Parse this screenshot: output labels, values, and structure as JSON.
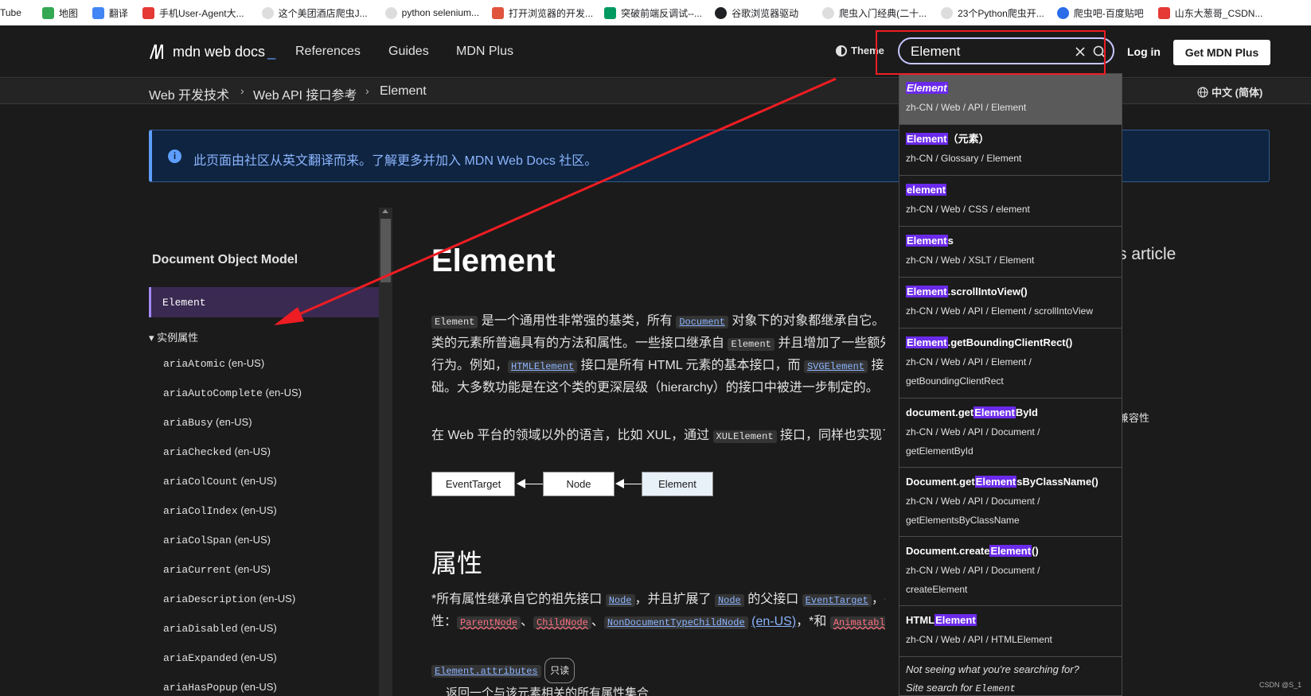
{
  "bookmarks": [
    {
      "label": "Tube",
      "color": "#ffffff"
    },
    {
      "label": "地图",
      "color": "#34a853"
    },
    {
      "label": "翻译",
      "color": "#4285f4"
    },
    {
      "label": "手机User-Agent大...",
      "color": "#e53935"
    },
    {
      "label": "这个美团酒店爬虫J...",
      "color": "#dddddd"
    },
    {
      "label": "python selenium...",
      "color": "#dddddd"
    },
    {
      "label": "打开浏览器的开发...",
      "color": "#e0533c"
    },
    {
      "label": "突破前端反调试--...",
      "color": "#009a61"
    },
    {
      "label": "谷歌浏览器驱动",
      "color": "#202124"
    },
    {
      "label": "爬虫入门经典(二十...",
      "color": "#dddddd"
    },
    {
      "label": "23个Python爬虫开...",
      "color": "#dddddd"
    },
    {
      "label": "爬虫吧-百度贴吧",
      "color": "#2b6de8"
    },
    {
      "label": "山东大葱哥_CSDN...",
      "color": "#e53935"
    }
  ],
  "header": {
    "logo_text": "mdn web docs",
    "logo_suffix": "_",
    "nav": [
      "References",
      "Guides",
      "MDN Plus"
    ],
    "theme_label": "Theme",
    "search_value": "Element",
    "login_label": "Log in",
    "cta_label": "Get MDN Plus"
  },
  "breadcrumb": {
    "items": [
      "Web 开发技术",
      "Web API 接口参考",
      "Element"
    ],
    "separator": "›",
    "language": "中文 (简体)"
  },
  "notice": {
    "icon": "i",
    "text": "此页面由社区从英文翻译而来。了解更多并加入 MDN Web Docs 社区。"
  },
  "sidebar": {
    "title": "Document Object Model",
    "active": "Element",
    "section": "▾ 实例属性",
    "note": "(en-US)",
    "items": [
      "ariaAtomic",
      "ariaAutoComplete",
      "ariaBusy",
      "ariaChecked",
      "ariaColCount",
      "ariaColIndex",
      "ariaColSpan",
      "ariaCurrent",
      "ariaDescription",
      "ariaDisabled",
      "ariaExpanded",
      "ariaHasPopup"
    ]
  },
  "main": {
    "title": "Element",
    "p1": {
      "l1_code": "Element",
      "l1_a": " 是一个通用性非常强的基类，所有 ",
      "l1_link": "Document",
      "l1_b": " 对象下的对象都继承自它。这",
      "l2_a": "类的元素所普遍具有的方法和属性。一些接口继承自 ",
      "l2_code": "Element",
      "l2_b": " 并且增加了一些额外功",
      "l3_a": "行为。例如，",
      "l3_link1": "HTMLElement",
      "l3_b": " 接口是所有 HTML 元素的基本接口，而 ",
      "l3_link2": "SVGElement",
      "l3_c": " 接口",
      "l4": "础。大多数功能是在这个类的更深层级（hierarchy）的接口中被进一步制定的。"
    },
    "p2": {
      "a": "在 Web 平台的领域以外的语言，比如 XUL，通过 ",
      "code": "XULElement",
      "b": " 接口，同样也实现了"
    },
    "diagram": [
      "EventTarget",
      "Node",
      "Element"
    ],
    "h2": "属性",
    "p3": {
      "l1_a": "*所有属性继承自它的祖先接口 ",
      "l1_link1": "Node",
      "l1_b": "，并且扩展了 ",
      "l1_link2": "Node",
      "l1_c": " 的父接口 ",
      "l1_link3": "EventTarget",
      "l1_d": "，并",
      "l2_a": "性：",
      "l2_b1": "ParentNode",
      "l2_sep": "、",
      "l2_b2": "ChildNode",
      "l2_link": "NonDocumentTypeChildNode",
      "l2_note": "(en-US)",
      "l2_c": "，*和 ",
      "l2_b3": "Animatable",
      "l2_d": "。"
    },
    "attr_link": "Element.attributes",
    "readonly_badge": "只读",
    "bottom_partial": "返回一个与该元素相关的所有属性集合"
  },
  "toc": {
    "heading_partial": "s article",
    "item_partial": "兼容性"
  },
  "dropdown": {
    "items": [
      {
        "pre": "",
        "hit": "Element",
        "post": "",
        "path": "zh-CN / Web / API / Element",
        "path2": ""
      },
      {
        "pre": "",
        "hit": "Element",
        "post": "（元素）",
        "path": "zh-CN / Glossary / Element",
        "path2": ""
      },
      {
        "pre": "",
        "hit": "element",
        "post": "",
        "path": "zh-CN / Web / CSS / element",
        "path2": ""
      },
      {
        "pre": "",
        "hit": "Element",
        "post": "s",
        "path": "zh-CN / Web / XSLT / Element",
        "path2": ""
      },
      {
        "pre": "",
        "hit": "Element",
        "post": ".scrollIntoView()",
        "path": "zh-CN / Web / API / Element / scrollIntoView",
        "path2": ""
      },
      {
        "pre": "",
        "hit": "Element",
        "post": ".getBoundingClientRect()",
        "path": "zh-CN / Web / API / Element /",
        "path2": "getBoundingClientRect"
      },
      {
        "pre": "document.get",
        "hit": "Element",
        "post": "ById",
        "path": "zh-CN / Web / API / Document /",
        "path2": "getElementById"
      },
      {
        "pre": "Document.get",
        "hit": "Element",
        "post": "sByClassName()",
        "path": "zh-CN / Web / API / Document /",
        "path2": "getElementsByClassName"
      },
      {
        "pre": "Document.create",
        "hit": "Element",
        "post": "()",
        "path": "zh-CN / Web / API / Document /",
        "path2": "createElement"
      },
      {
        "pre": "HTML",
        "hit": "Element",
        "post": "",
        "path": "zh-CN / Web / API / HTMLElement",
        "path2": ""
      }
    ],
    "footer_q": "Not seeing what you're searching for?",
    "footer_a": "Site search for ",
    "footer_term": "Element"
  },
  "watermark": "CSDN @S_1"
}
